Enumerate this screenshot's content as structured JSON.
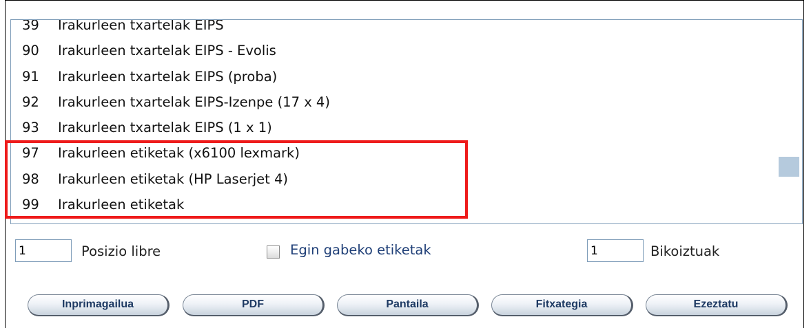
{
  "list": {
    "items": [
      {
        "code": "39",
        "name": "Irakurleen txartelak EIPS"
      },
      {
        "code": "90",
        "name": "Irakurleen txartelak EIPS - Evolis"
      },
      {
        "code": "91",
        "name": "Irakurleen txartelak EIPS (proba)"
      },
      {
        "code": "92",
        "name": "Irakurleen txartelak EIPS-Izenpe (17 x 4)"
      },
      {
        "code": "93",
        "name": "Irakurleen txartelak EIPS (1 x 1)"
      },
      {
        "code": "97",
        "name": "Irakurleen etiketak (x6100 lexmark)"
      },
      {
        "code": "98",
        "name": "Irakurleen etiketak (HP Laserjet 4)"
      },
      {
        "code": "99",
        "name": "Irakurleen etiketak"
      }
    ]
  },
  "options": {
    "free_position_value": "1",
    "free_position_label": "Posizio libre",
    "unprinted_label": "Egin gabeko etiketak",
    "unprinted_checked": false,
    "duplicates_value": "1",
    "duplicates_label": "Bikoiztuak"
  },
  "buttons": {
    "printer": "Inprimagailua",
    "pdf": "PDF",
    "screen": "Pantaila",
    "file": "Fitxategia",
    "cancel": "Ezeztatu"
  },
  "colors": {
    "highlight": "#ee1b1b",
    "checkbox_label": "#1f3f77",
    "button_text": "#1e3a63"
  }
}
